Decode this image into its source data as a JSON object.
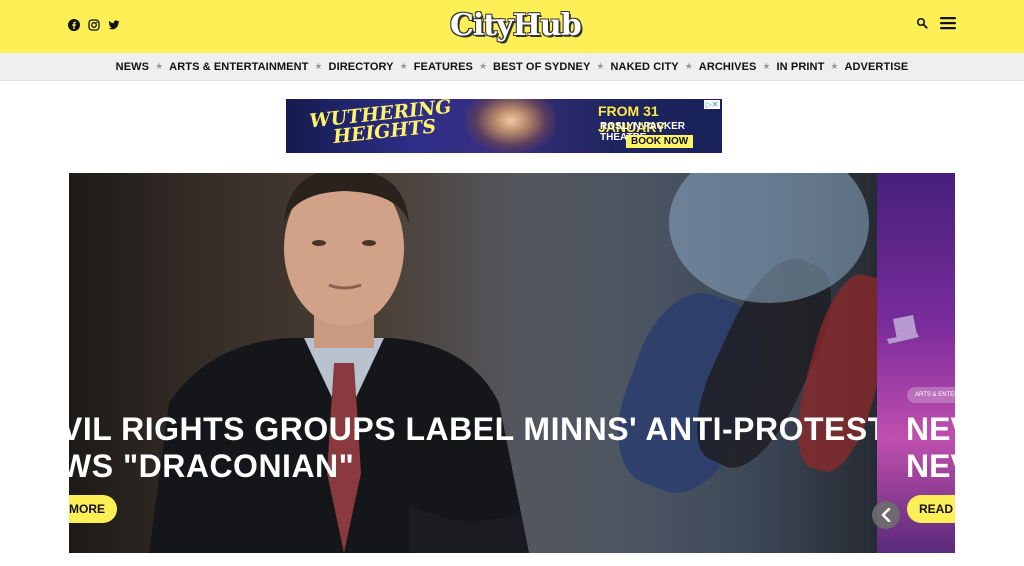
{
  "header": {
    "logo_text": "CityHub",
    "social": [
      {
        "icon": "facebook-icon"
      },
      {
        "icon": "instagram-icon"
      },
      {
        "icon": "twitter-icon"
      }
    ],
    "accent_color": "#fdf056"
  },
  "nav": {
    "items": [
      {
        "label": "NEWS"
      },
      {
        "label": "ARTS & ENTERTAINMENT"
      },
      {
        "label": "DIRECTORY"
      },
      {
        "label": "FEATURES"
      },
      {
        "label": "BEST OF SYDNEY"
      },
      {
        "label": "NAKED CITY"
      },
      {
        "label": "ARCHIVES"
      },
      {
        "label": "IN PRINT"
      },
      {
        "label": "ADVERTISE"
      }
    ],
    "separator": "★"
  },
  "ad": {
    "title_line1": "WUTHERING",
    "title_line2": "HEIGHTS",
    "date": "FROM 31 JANUARY",
    "venue": "ROSLYN PACKER THEATRE",
    "cta": "BOOK NOW"
  },
  "slider": {
    "current": {
      "headline_line1": "VIL RIGHTS GROUPS LABEL MINNS' ANTI-PROTEST",
      "headline_line2": "WS \"DRACONIAN\"",
      "button": "MORE"
    },
    "next": {
      "category": "ARTS & ENTERT",
      "headline_line1": "NEV",
      "headline_line2": "NEV",
      "button": "READ M"
    }
  }
}
